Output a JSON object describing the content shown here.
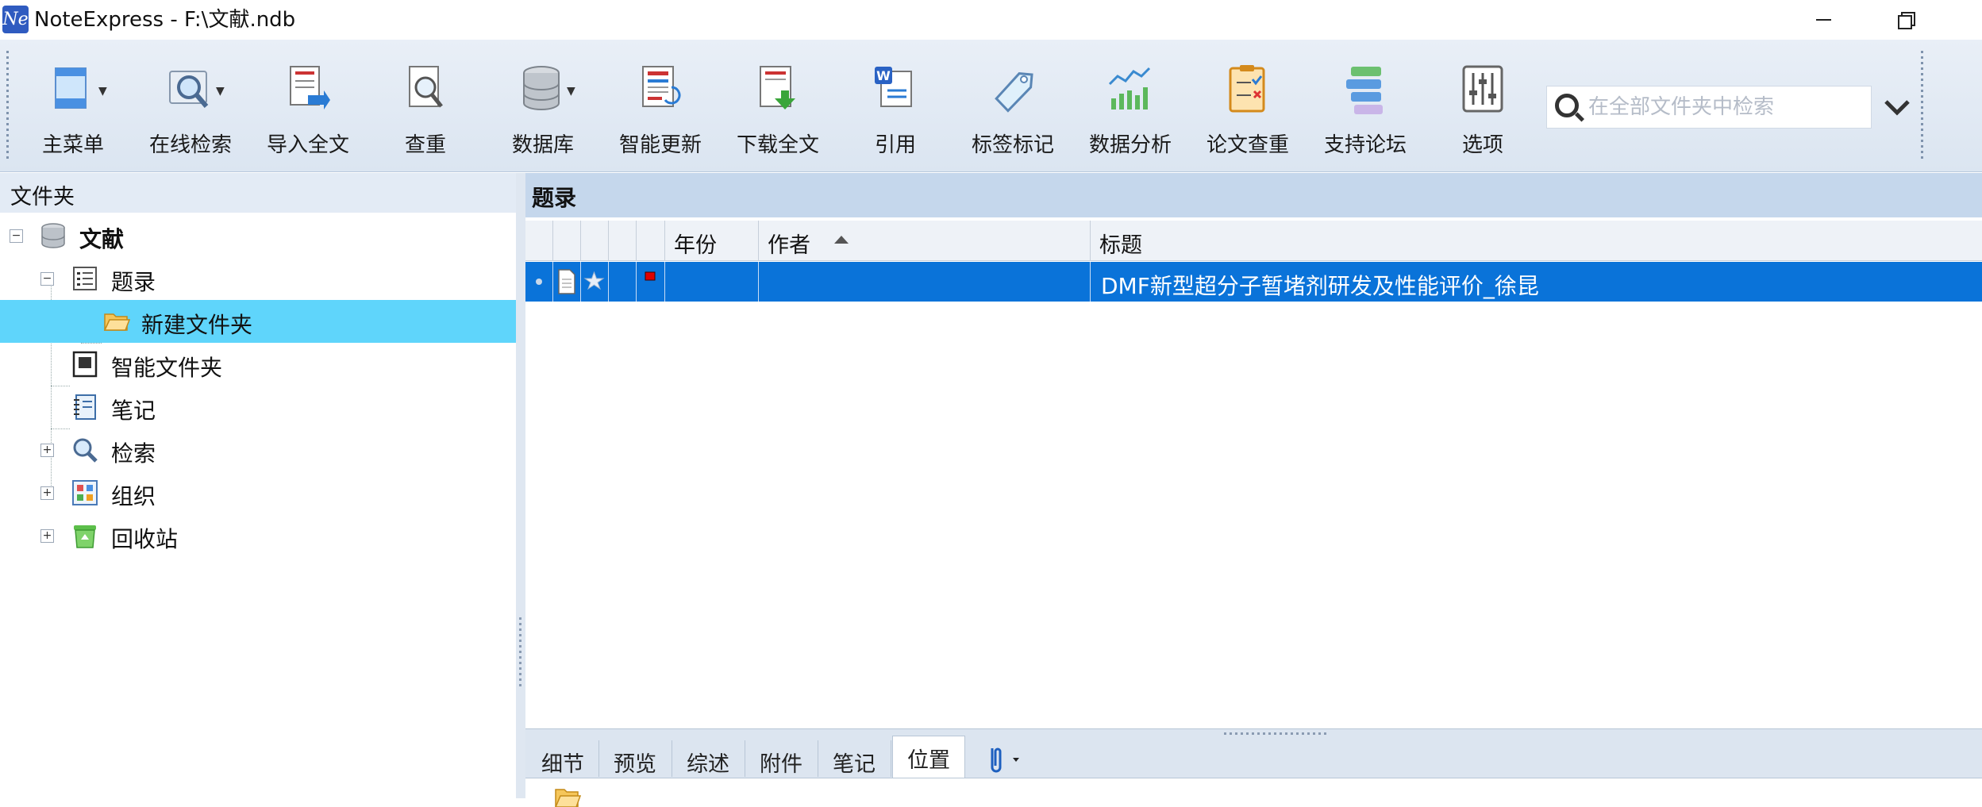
{
  "window": {
    "logo_text": "Ne",
    "title": "NoteExpress - F:\\文献.ndb"
  },
  "toolbar": {
    "buttons": [
      {
        "label": "主菜单",
        "icon": "main-menu-icon",
        "has_dropdown": true
      },
      {
        "label": "在线检索",
        "icon": "online-search-icon",
        "has_dropdown": true
      },
      {
        "label": "导入全文",
        "icon": "import-fulltext-icon"
      },
      {
        "label": "查重",
        "icon": "check-duplicate-icon"
      },
      {
        "label": "数据库",
        "icon": "database-icon",
        "has_dropdown": true
      },
      {
        "label": "智能更新",
        "icon": "smart-update-icon"
      },
      {
        "label": "下载全文",
        "icon": "download-fulltext-icon"
      },
      {
        "label": "引用",
        "icon": "cite-icon"
      },
      {
        "label": "标签标记",
        "icon": "tag-icon"
      },
      {
        "label": "数据分析",
        "icon": "data-analysis-icon"
      },
      {
        "label": "论文查重",
        "icon": "paper-check-icon"
      },
      {
        "label": "支持论坛",
        "icon": "forum-icon"
      },
      {
        "label": "选项",
        "icon": "options-icon"
      }
    ],
    "search_placeholder": "在全部文件夹中检索"
  },
  "folder_pane": {
    "header": "文件夹",
    "tree": [
      {
        "label": "文献",
        "icon": "database-icon",
        "level": 0,
        "expander": "−",
        "bold": true
      },
      {
        "label": "题录",
        "icon": "list-icon",
        "level": 1,
        "expander": "−"
      },
      {
        "label": "新建文件夹",
        "icon": "folder-open-icon",
        "level": 2,
        "selected": true
      },
      {
        "label": "智能文件夹",
        "icon": "smart-folder-icon",
        "level": 1
      },
      {
        "label": "笔记",
        "icon": "notebook-icon",
        "level": 1
      },
      {
        "label": "检索",
        "icon": "search-icon",
        "level": 1,
        "expander": "+"
      },
      {
        "label": "组织",
        "icon": "organize-icon",
        "level": 1,
        "expander": "+"
      },
      {
        "label": "回收站",
        "icon": "recycle-bin-icon",
        "level": 1,
        "expander": "+"
      }
    ]
  },
  "records_pane": {
    "header": "题录",
    "columns": [
      "",
      "",
      "",
      "",
      "",
      "年份",
      "作者",
      "标题"
    ],
    "sorted_column": "作者",
    "sort_direction": "ascending",
    "rows": [
      {
        "year": "",
        "author": "",
        "title": "DMF新型超分子暂堵剂研发及性能评价_徐昆",
        "selected": true
      }
    ]
  },
  "bottom_tabs": {
    "tabs": [
      "细节",
      "预览",
      "综述",
      "附件",
      "笔记",
      "位置"
    ],
    "active": "位置"
  },
  "colors": {
    "selection_blue": "#0a73d9",
    "tree_selection": "#5fd5fb",
    "toolbar_bg": "#dbe5f1",
    "flag_red": "#e00000"
  }
}
